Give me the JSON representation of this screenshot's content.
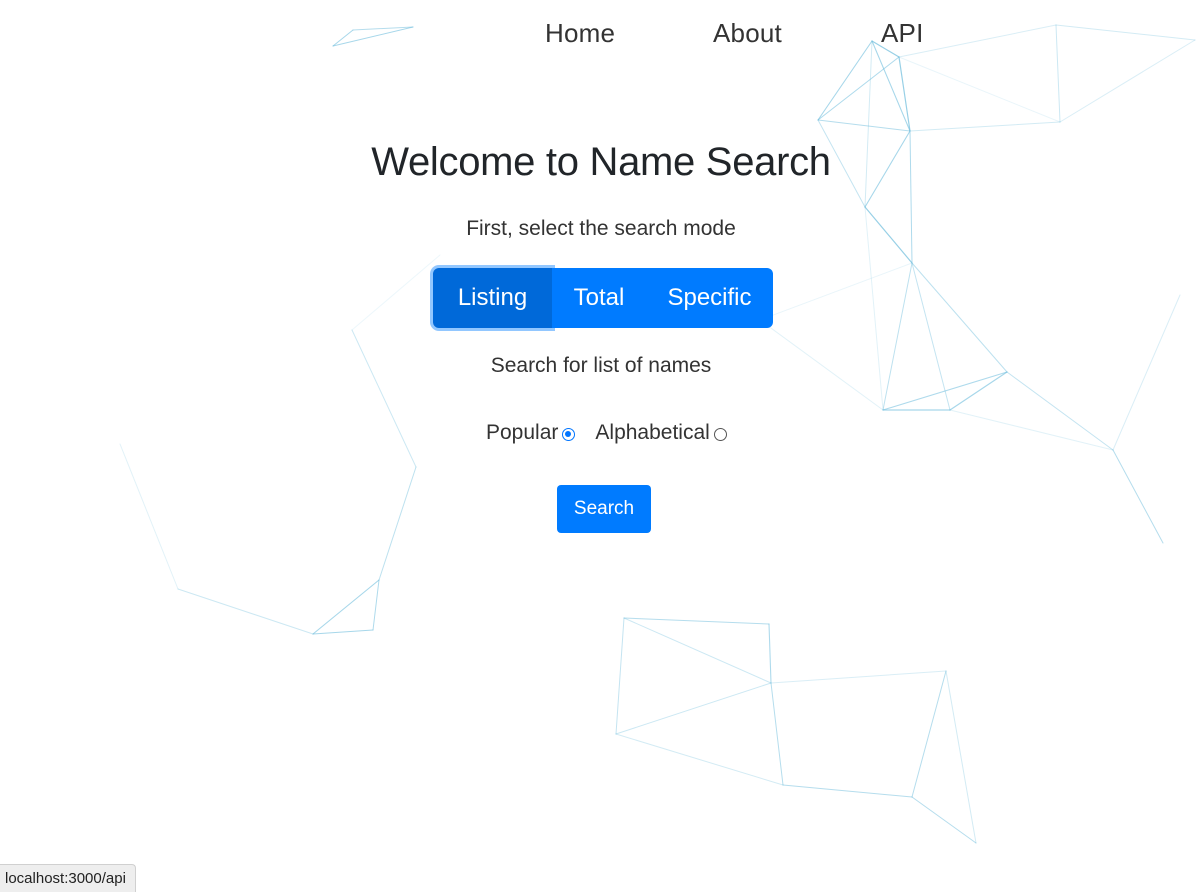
{
  "nav": {
    "items": [
      {
        "label": "Home"
      },
      {
        "label": "About"
      },
      {
        "label": "API"
      }
    ]
  },
  "main": {
    "title": "Welcome to Name Search",
    "subtitle": "First, select the search mode",
    "modes": [
      {
        "label": "Listing",
        "active": true
      },
      {
        "label": "Total",
        "active": false
      },
      {
        "label": "Specific",
        "active": false
      }
    ],
    "mode_description": "Search for list of names",
    "sort_options": [
      {
        "label": "Popular",
        "checked": true
      },
      {
        "label": "Alphabetical",
        "checked": false
      }
    ],
    "search_label": "Search"
  },
  "status_bar": {
    "url": "localhost:3000/api"
  },
  "colors": {
    "primary": "#007bff",
    "primary_active": "#0069d9",
    "background_lines": "#8ecae6"
  }
}
